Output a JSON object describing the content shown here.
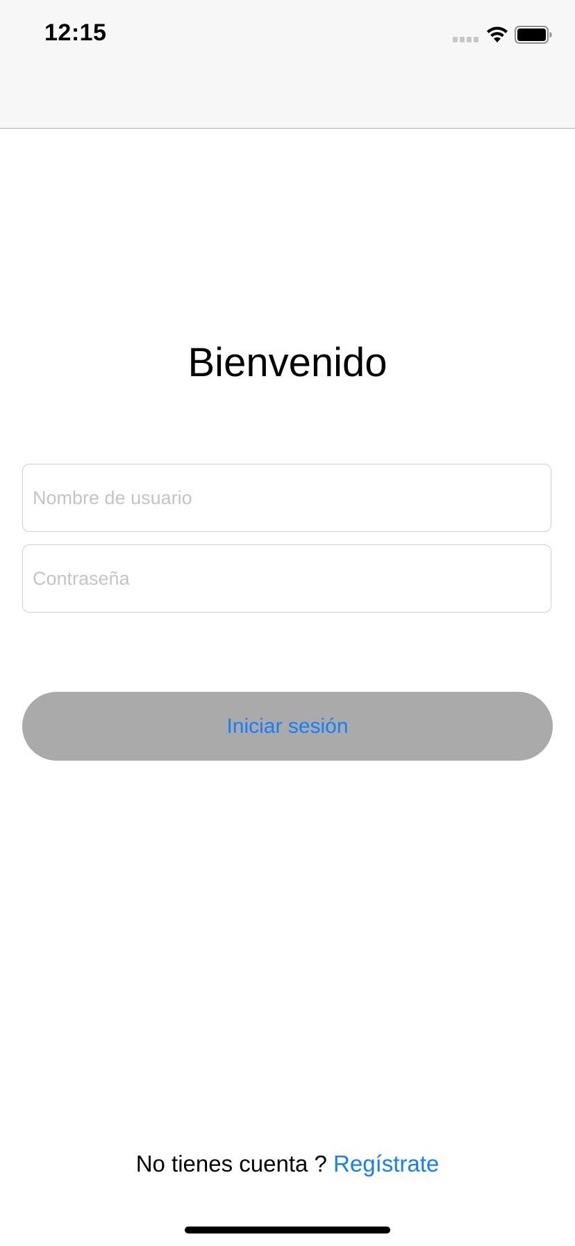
{
  "status_bar": {
    "time": "12:15",
    "icons": [
      "cellular-signal-icon",
      "wifi-icon",
      "battery-icon"
    ]
  },
  "login": {
    "title": "Bienvenido",
    "username_placeholder": "Nombre de usuario",
    "username_value": "",
    "password_placeholder": "Contraseña",
    "password_value": "",
    "submit_label": "Iniciar sesión"
  },
  "footer": {
    "prompt": "No tienes cuenta ? ",
    "register_label": "Regístrate"
  },
  "colors": {
    "accent": "#147efb",
    "button_background": "#aaaaaa",
    "nav_background": "#f7f7f7",
    "placeholder": "#c4c4c8"
  }
}
